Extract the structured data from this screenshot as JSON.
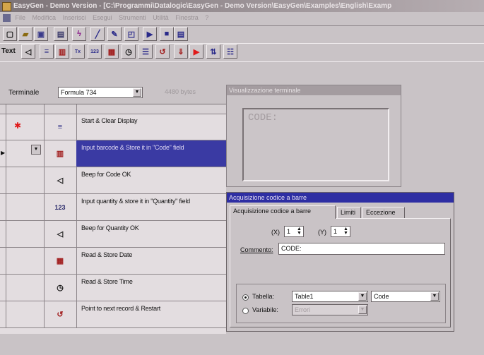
{
  "window": {
    "title": "EasyGen - Demo Version - [C:\\Programmi\\Datalogic\\EasyGen - Demo Version\\EasyGen\\Examples\\English\\Examp"
  },
  "menu": [
    "File",
    "Modifica",
    "Inserisci",
    "Esegui",
    "Strumenti",
    "Utilità",
    "Finestra",
    "?"
  ],
  "toolbar2": {
    "text_label": "Text"
  },
  "terminal": {
    "label": "Terminale",
    "selected": "Formula 734",
    "bytes": "4480 bytes"
  },
  "program": {
    "rows": [
      {
        "step": "Start & Clear Display",
        "icon": "clear-display-icon",
        "glyph": "≡",
        "marker": "✱"
      },
      {
        "step": "Input barcode & Store it in \"Code\" field",
        "icon": "barcode-icon",
        "glyph": "▥",
        "selected": true
      },
      {
        "step": "Beep for Code OK",
        "icon": "beep-icon",
        "glyph": "◁"
      },
      {
        "step": "Input quantity & store it in \"Quantity\" field",
        "icon": "quantity-123-icon",
        "glyph": "123"
      },
      {
        "step": "Beep for Quantity OK",
        "icon": "beep-icon",
        "glyph": "◁"
      },
      {
        "step": "Read & Store Date",
        "icon": "calendar-icon",
        "glyph": "▦"
      },
      {
        "step": "Read & Store Time",
        "icon": "clock-icon",
        "glyph": "◷"
      },
      {
        "step": "Point to next record & Restart",
        "icon": "restart-icon",
        "glyph": "↺"
      }
    ]
  },
  "terminal_view": {
    "title": "Visualizzazione terminale",
    "display_text": "CODE:"
  },
  "barcode_dialog": {
    "title": "Acquisizione codice a barre",
    "tabs": [
      "Acquisizione codice a barre",
      "Limiti",
      "Eccezione"
    ],
    "x_label": "(X)",
    "x_value": "1",
    "y_label": "(Y)",
    "y_value": "1",
    "comment_label": "Commento:",
    "comment_value": "CODE:",
    "table_label": "Tabella:",
    "table_value": "Table1",
    "field_value": "Code",
    "variable_label": "Variabile:",
    "variable_value": "Errori"
  }
}
